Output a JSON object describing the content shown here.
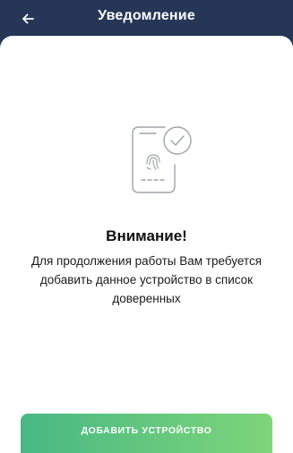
{
  "header": {
    "title": "Уведомление",
    "back_icon": "arrow-left-icon",
    "background_color": "#253656"
  },
  "illustration": {
    "icon": "phone-fingerprint-check-icon",
    "stroke_color": "#a0a4ab"
  },
  "content": {
    "title": "Внимание!",
    "message": "Для продолжения работы Вам требуется добавить данное устройство в список доверенных"
  },
  "action": {
    "add_device_label": "ДОБАВИТЬ УСТРОЙСТВО",
    "gradient_start": "#48b884",
    "gradient_end": "#7ed57a"
  }
}
